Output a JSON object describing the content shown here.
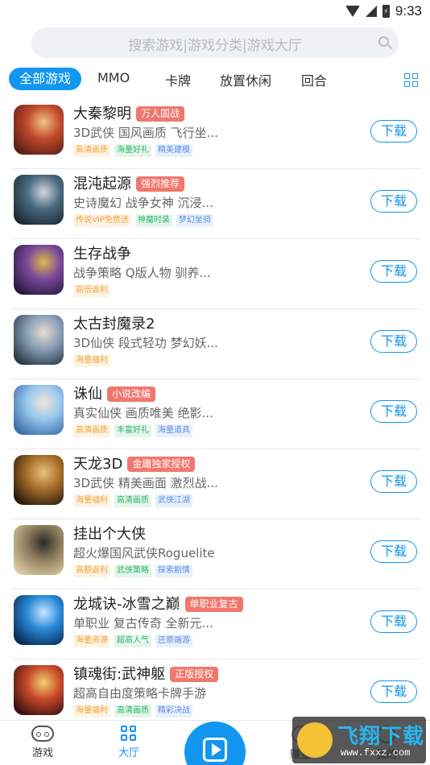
{
  "statusbar": {
    "time": "9:33",
    "battery_glyph": "⚡"
  },
  "search": {
    "placeholder": "搜索游戏|游戏分类|游戏大厅"
  },
  "tabs": [
    {
      "label": "全部游戏",
      "active": true
    },
    {
      "label": "MMO"
    },
    {
      "label": "卡牌"
    },
    {
      "label": "放置休闲"
    },
    {
      "label": "回合"
    }
  ],
  "download_label": "下载",
  "games": [
    {
      "name": "大秦黎明",
      "badge": "万人国战",
      "desc": "3D武侠 国风画质 飞行坐...",
      "tags": [
        [
          "高清画质",
          "orange"
        ],
        [
          "海量好礼",
          "green"
        ],
        [
          "精美建模",
          "blue"
        ]
      ],
      "colors": [
        "#5a1f18",
        "#c24a2c",
        "#f0c38a"
      ]
    },
    {
      "name": "混沌起源",
      "badge": "强烈推荐",
      "desc": "史诗魔幻 战争女神 沉浸...",
      "tags": [
        [
          "传说VIP免费送",
          "orange"
        ],
        [
          "神魔时装",
          "green"
        ],
        [
          "梦幻坐骑",
          "blue"
        ]
      ],
      "colors": [
        "#1b2a35",
        "#4b6a80",
        "#cfd8e0"
      ]
    },
    {
      "name": "生存战争",
      "badge": "",
      "desc": "战争策略 Q版人物 驯养...",
      "tags": [
        [
          "高倍返利",
          "orange"
        ]
      ],
      "colors": [
        "#2a1a40",
        "#7b4a9a",
        "#e0b84a"
      ]
    },
    {
      "name": "太古封魔录2",
      "badge": "",
      "desc": "3D仙侠 段式轻功 梦幻妖...",
      "tags": [
        [
          "海量福利",
          "orange"
        ]
      ],
      "colors": [
        "#2c3a4a",
        "#8aa0b8",
        "#e8dcd0"
      ]
    },
    {
      "name": "诛仙",
      "badge": "小说改编",
      "desc": "真实仙侠 画质唯美 绝影...",
      "tags": [
        [
          "高清画质",
          "orange"
        ],
        [
          "丰富好礼",
          "green"
        ],
        [
          "海量道具",
          "blue"
        ]
      ],
      "colors": [
        "#3a6fa8",
        "#9ac8ee",
        "#f2e6d6"
      ]
    },
    {
      "name": "天龙3D",
      "badge": "金庸独家授权",
      "desc": "3D武侠 精美画面 激烈战...",
      "tags": [
        [
          "海量福利",
          "orange"
        ],
        [
          "高清画质",
          "green"
        ],
        [
          "武侠江湖",
          "blue"
        ]
      ],
      "colors": [
        "#2b1a0c",
        "#a8702a",
        "#e8c27a"
      ]
    },
    {
      "name": "挂出个大侠",
      "badge": "",
      "desc": "超火爆国风武侠Roguelite",
      "tags": [
        [
          "高额返利",
          "orange"
        ],
        [
          "武侠策略",
          "green"
        ],
        [
          "探索剧情",
          "blue"
        ]
      ],
      "colors": [
        "#d9c9a0",
        "#8a7a5a",
        "#2a2a2a"
      ]
    },
    {
      "name": "龙城诀-冰雪之巅",
      "badge": "单职业复古",
      "desc": "单职业 复古传奇 全新元...",
      "tags": [
        [
          "海量资源",
          "orange"
        ],
        [
          "超高人气",
          "green"
        ],
        [
          "还原端游",
          "blue"
        ]
      ],
      "colors": [
        "#0a2a55",
        "#2a8ad8",
        "#c8e6ff"
      ]
    },
    {
      "name": "镇魂街:武神躯",
      "badge": "正版授权",
      "desc": "超高自由度策略卡牌手游",
      "tags": [
        [
          "海量福利",
          "orange"
        ],
        [
          "高清画质",
          "green"
        ],
        [
          "精彩决战",
          "blue"
        ]
      ],
      "colors": [
        "#3a1010",
        "#c84a2a",
        "#f0d070"
      ]
    }
  ],
  "bottomnav": {
    "games": "游戏",
    "hall": "大厅",
    "earn": "赚金",
    "mine": "我的"
  },
  "watermark": {
    "text": "飞翔下载",
    "url": "www.fxxz.com"
  },
  "colors": {
    "accent": "#1296f0",
    "badge": "#f0776c"
  }
}
